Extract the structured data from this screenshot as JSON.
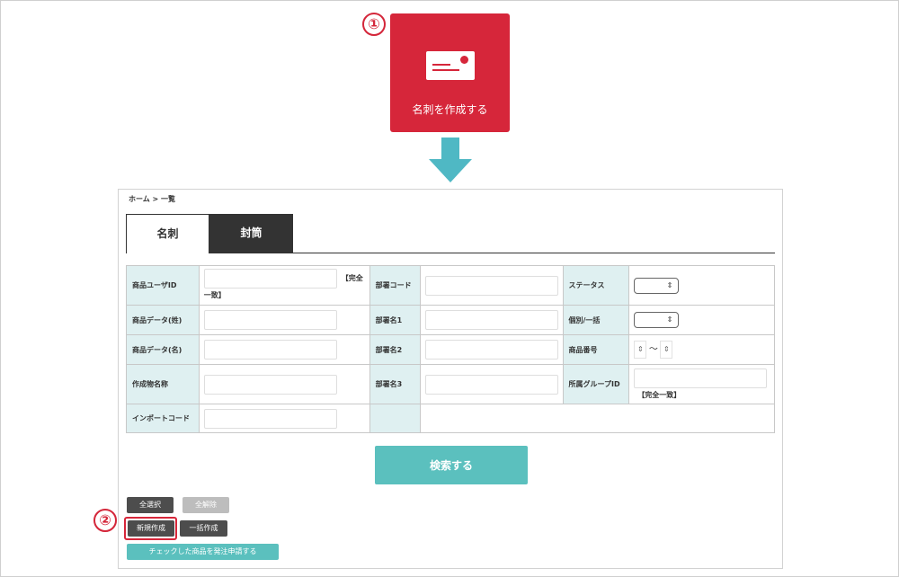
{
  "callouts": [
    "①",
    "②"
  ],
  "hero": {
    "label": "名刺を作成する",
    "icon": "business-card-icon",
    "color": "#d6263a"
  },
  "breadcrumb": "ホーム > 一覧",
  "tabs": [
    {
      "label": "名刺",
      "active": true
    },
    {
      "label": "封筒",
      "active": false
    }
  ],
  "form": {
    "product_user_id": "商品ユーザID",
    "exact_match_a": "【完全",
    "exact_match_b": "一致】",
    "dept_code": "部署コード",
    "status": "ステータス",
    "product_data_last": "商品データ(姓)",
    "dept_name1": "部署名1",
    "individual_bulk": "個別/一括",
    "product_data_first": "商品データ(名)",
    "dept_name2": "部署名2",
    "product_number": "商品番号",
    "tilde": "〜",
    "artifact_name": "作成物名称",
    "dept_name3": "部署名3",
    "group_id": "所属グループID",
    "exact_match": "【完全一致】",
    "import_code": "インポートコード"
  },
  "buttons": {
    "search": "検索する",
    "select_all": "全選択",
    "clear_all": "全解除",
    "new": "新規作成",
    "bulk": "一括作成",
    "order": "チェックした商品を発注申請する"
  },
  "colors": {
    "accent": "#5bc0be",
    "brand": "#d6263a",
    "label_bg": "#dff0f1"
  }
}
